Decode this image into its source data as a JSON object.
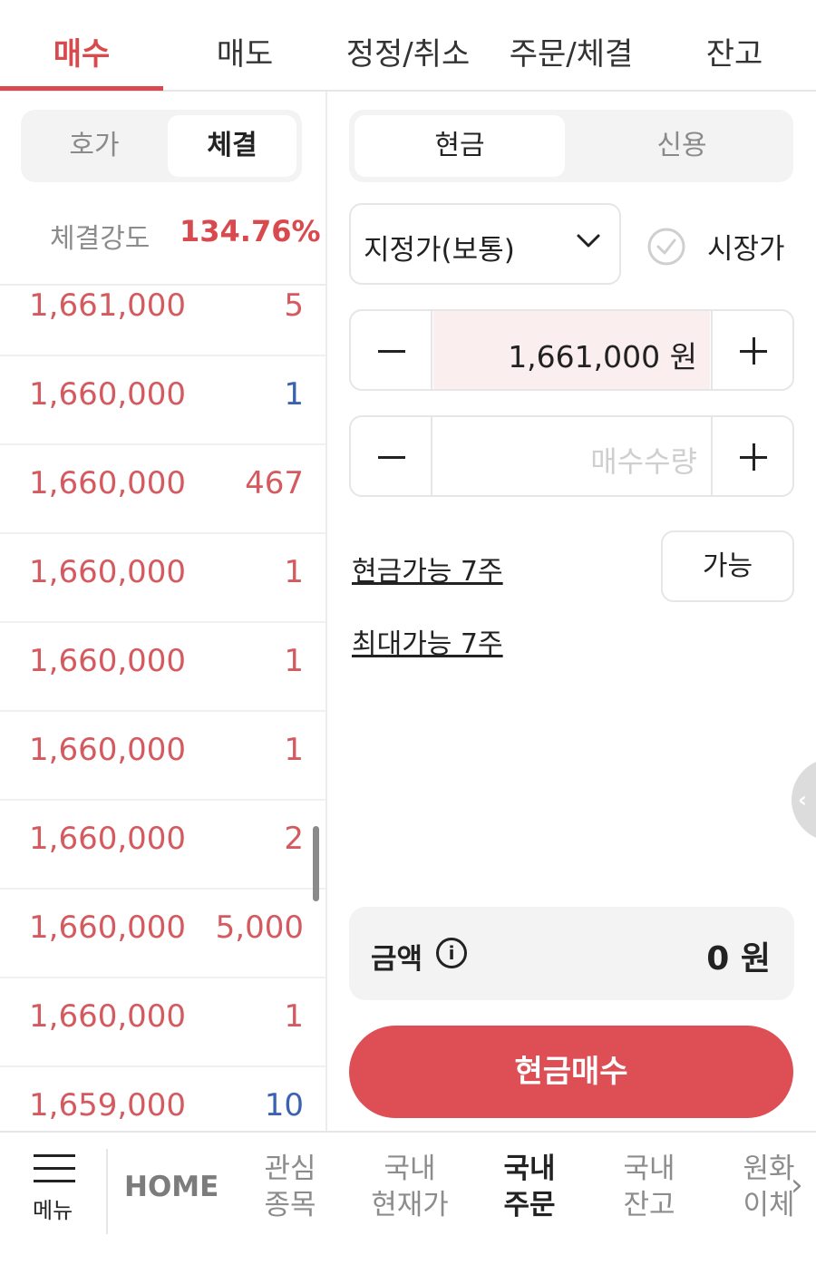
{
  "top_tabs": [
    "매수",
    "매도",
    "정정/취소",
    "주문/체결",
    "잔고"
  ],
  "left_segment": {
    "options": [
      "호가",
      "체결"
    ],
    "selected": "체결"
  },
  "trade_strength": {
    "label": "체결강도",
    "value": "134.76%"
  },
  "trades": [
    {
      "price": "1,661,000",
      "qty": "5",
      "color": "#d45a60"
    },
    {
      "price": "1,660,000",
      "qty": "1",
      "color": "#3a62b3"
    },
    {
      "price": "1,660,000",
      "qty": "467",
      "color": "#d45a60"
    },
    {
      "price": "1,660,000",
      "qty": "1",
      "color": "#d45a60"
    },
    {
      "price": "1,660,000",
      "qty": "1",
      "color": "#d45a60"
    },
    {
      "price": "1,660,000",
      "qty": "1",
      "color": "#d45a60"
    },
    {
      "price": "1,660,000",
      "qty": "2",
      "color": "#d45a60"
    },
    {
      "price": "1,660,000",
      "qty": "5,000",
      "color": "#d45a60"
    },
    {
      "price": "1,660,000",
      "qty": "1",
      "color": "#d45a60"
    },
    {
      "price": "1,659,000",
      "qty": "10",
      "color": "#3a62b3"
    }
  ],
  "right_segment": {
    "options": [
      "현금",
      "신용"
    ],
    "selected": "현금"
  },
  "order_type": {
    "label": "지정가(보통)",
    "market_label": "시장가"
  },
  "price_input": {
    "value": "1,661,000 원"
  },
  "qty_input": {
    "placeholder": "매수수량"
  },
  "cash_available": "현금가능 7주",
  "max_available": "최대가능 7주",
  "possible_button": "가능",
  "amount": {
    "label": "금액",
    "value": "0 원",
    "info_icon": "i"
  },
  "buy_button": "현금매수",
  "bottom_nav": {
    "menu_label": "메뉴",
    "home": "HOME",
    "items": [
      {
        "line1": "관심",
        "line2": "종목"
      },
      {
        "line1": "국내",
        "line2": "현재가"
      },
      {
        "line1": "국내",
        "line2": "주문"
      },
      {
        "line1": "국내",
        "line2": "잔고"
      },
      {
        "line1": "원화",
        "line2": "이체"
      }
    ]
  },
  "colors": {
    "accent": "#dd4e55",
    "up": "#d45a60",
    "down": "#3a62b3"
  }
}
